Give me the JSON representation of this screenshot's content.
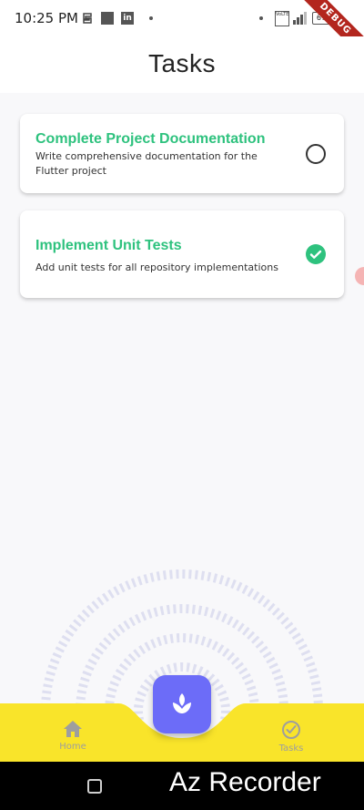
{
  "status_bar": {
    "time": "10:25 PM",
    "battery": "67",
    "volte": "VoLTE"
  },
  "debug_banner": "DEBUG",
  "app_bar": {
    "title": "Tasks"
  },
  "tasks": [
    {
      "title": "Complete Project Documentation",
      "description": "Write comprehensive documentation for the Flutter project",
      "completed": false
    },
    {
      "title": "Implement Unit Tests",
      "description": "Add unit tests for all repository implementations",
      "completed": true
    }
  ],
  "bottom_nav": {
    "items": [
      {
        "label": "Home",
        "icon": "home-icon"
      },
      {
        "label": "Tasks",
        "icon": "check-circle-icon"
      }
    ],
    "fab_icon": "lotus-icon"
  },
  "system_nav": {
    "overlay_text": "Az Recorder"
  },
  "colors": {
    "accent_green": "#2ec27e",
    "fab": "#6c6cf8",
    "nav_bar": "#f9e42a"
  }
}
